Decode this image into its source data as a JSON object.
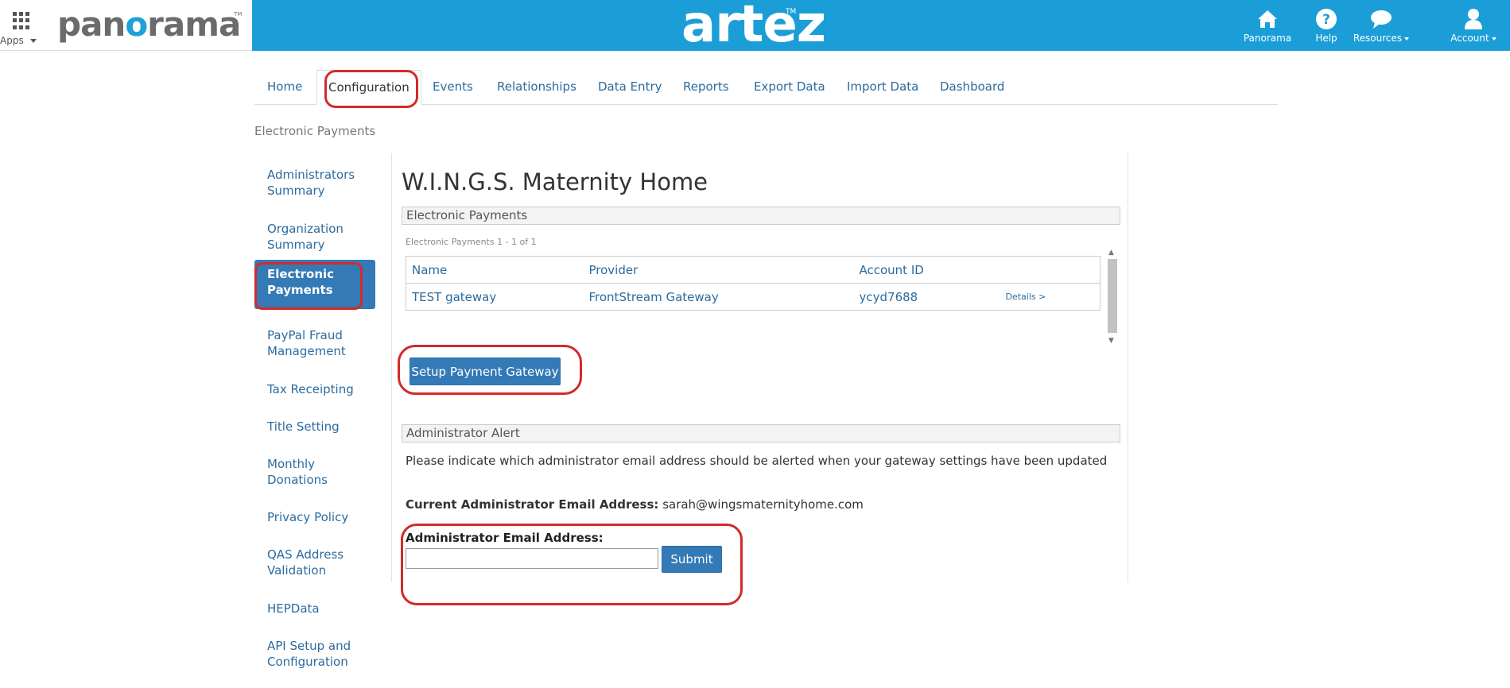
{
  "header": {
    "apps_label": "Apps",
    "left_logo_text": "pan",
    "left_logo_o": "o",
    "left_logo_rest": "rama",
    "left_logo_tm": "TM",
    "center_logo_text": "artez",
    "center_logo_tm": "TM",
    "brand_color": "#1b9ed8",
    "nav": [
      {
        "label": "Panorama",
        "icon": "home-icon"
      },
      {
        "label": "Help",
        "icon": "help-icon"
      },
      {
        "label": "Resources",
        "icon": "chat-bubble-icon",
        "has_dropdown": true
      },
      {
        "label": "Account",
        "icon": "user-icon",
        "has_dropdown": true
      }
    ]
  },
  "tabs": [
    {
      "label": "Home"
    },
    {
      "label": "Configuration",
      "active": true
    },
    {
      "label": "Events"
    },
    {
      "label": "Relationships"
    },
    {
      "label": "Data Entry"
    },
    {
      "label": "Reports"
    },
    {
      "label": "Export Data"
    },
    {
      "label": "Import Data"
    },
    {
      "label": "Dashboard"
    }
  ],
  "breadcrumb": "Electronic Payments",
  "sidebar": {
    "items": [
      {
        "label": "Administrators Summary"
      },
      {
        "label": "Organization Summary"
      },
      {
        "label": "Electronic Payments",
        "active": true
      },
      {
        "label": "PayPal Fraud Management"
      },
      {
        "label": "Tax Receipting"
      },
      {
        "label": "Title Setting"
      },
      {
        "label": "Monthly Donations"
      },
      {
        "label": "Privacy Policy"
      },
      {
        "label": "QAS Address Validation"
      },
      {
        "label": "HEPData"
      },
      {
        "label": "API Setup and Configuration"
      }
    ]
  },
  "main": {
    "title": "W.I.N.G.S. Maternity Home",
    "payments_section": {
      "header": "Electronic Payments",
      "count_note": "Electronic Payments 1 - 1 of 1",
      "columns": [
        "Name",
        "Provider",
        "Account ID"
      ],
      "rows": [
        {
          "name": "TEST gateway",
          "provider": "FrontStream Gateway",
          "account_id": "ycyd7688",
          "details": "Details >"
        }
      ],
      "setup_button": "Setup Payment Gateway"
    },
    "alert_section": {
      "header": "Administrator Alert",
      "description": "Please indicate which administrator email address should be alerted when your gateway settings have been updated",
      "current_label": "Current Administrator Email Address:",
      "current_value": "sarah@wingsmaternityhome.com",
      "field_label": "Administrator Email Address:",
      "field_value": "",
      "submit_button": "Submit"
    }
  },
  "annotation_color": "#d42a2a"
}
